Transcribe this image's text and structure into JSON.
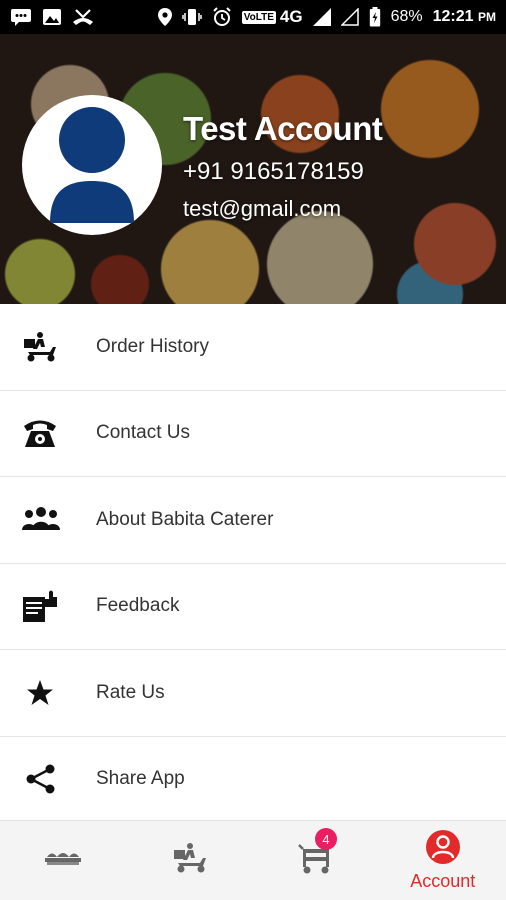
{
  "status_bar": {
    "volte": "VoLTE",
    "network": "4G",
    "battery_pct": "68%",
    "time": "12:21",
    "time_suffix": "PM"
  },
  "profile": {
    "name": "Test Account",
    "phone": "+91 9165178159",
    "email": "test@gmail.com"
  },
  "menu": [
    {
      "label": "Order History",
      "icon": "delivery-scooter-icon"
    },
    {
      "label": "Contact Us",
      "icon": "telephone-icon"
    },
    {
      "label": "About Babita Caterer",
      "icon": "group-icon"
    },
    {
      "label": "Feedback",
      "icon": "feedback-icon"
    },
    {
      "label": "Rate Us",
      "icon": "star-icon"
    },
    {
      "label": "Share App",
      "icon": "share-icon"
    }
  ],
  "bottom_nav": {
    "home_icon": "catering-home-icon",
    "orders_icon": "delivery-scooter-icon",
    "cart_icon": "cart-icon",
    "cart_badge": "4",
    "account_label": "Account",
    "account_icon": "account-icon"
  },
  "colors": {
    "accent": "#e22a2a",
    "badge": "#e91e63",
    "avatar": "#0f3b7a"
  }
}
